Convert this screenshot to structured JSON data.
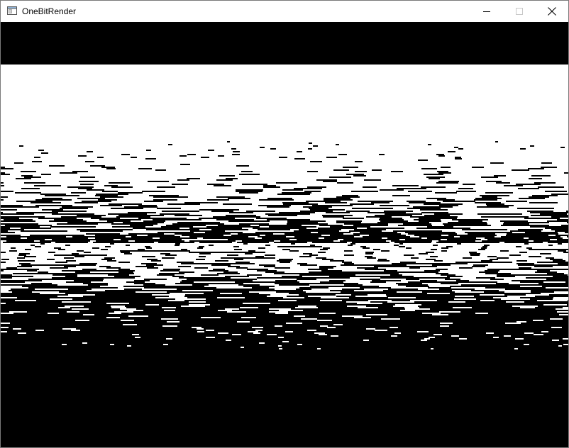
{
  "window": {
    "title": "OneBitRender",
    "app_icon": "window-app-icon",
    "controls": {
      "minimize_icon": "minimize-icon",
      "maximize_icon": "maximize-icon",
      "close_icon": "close-icon"
    }
  },
  "viewport": {
    "description_colors": {
      "background": "#000000",
      "foreground": "#ffffff",
      "titlebar": "#ffffff",
      "border": "#7a7a7a"
    }
  }
}
